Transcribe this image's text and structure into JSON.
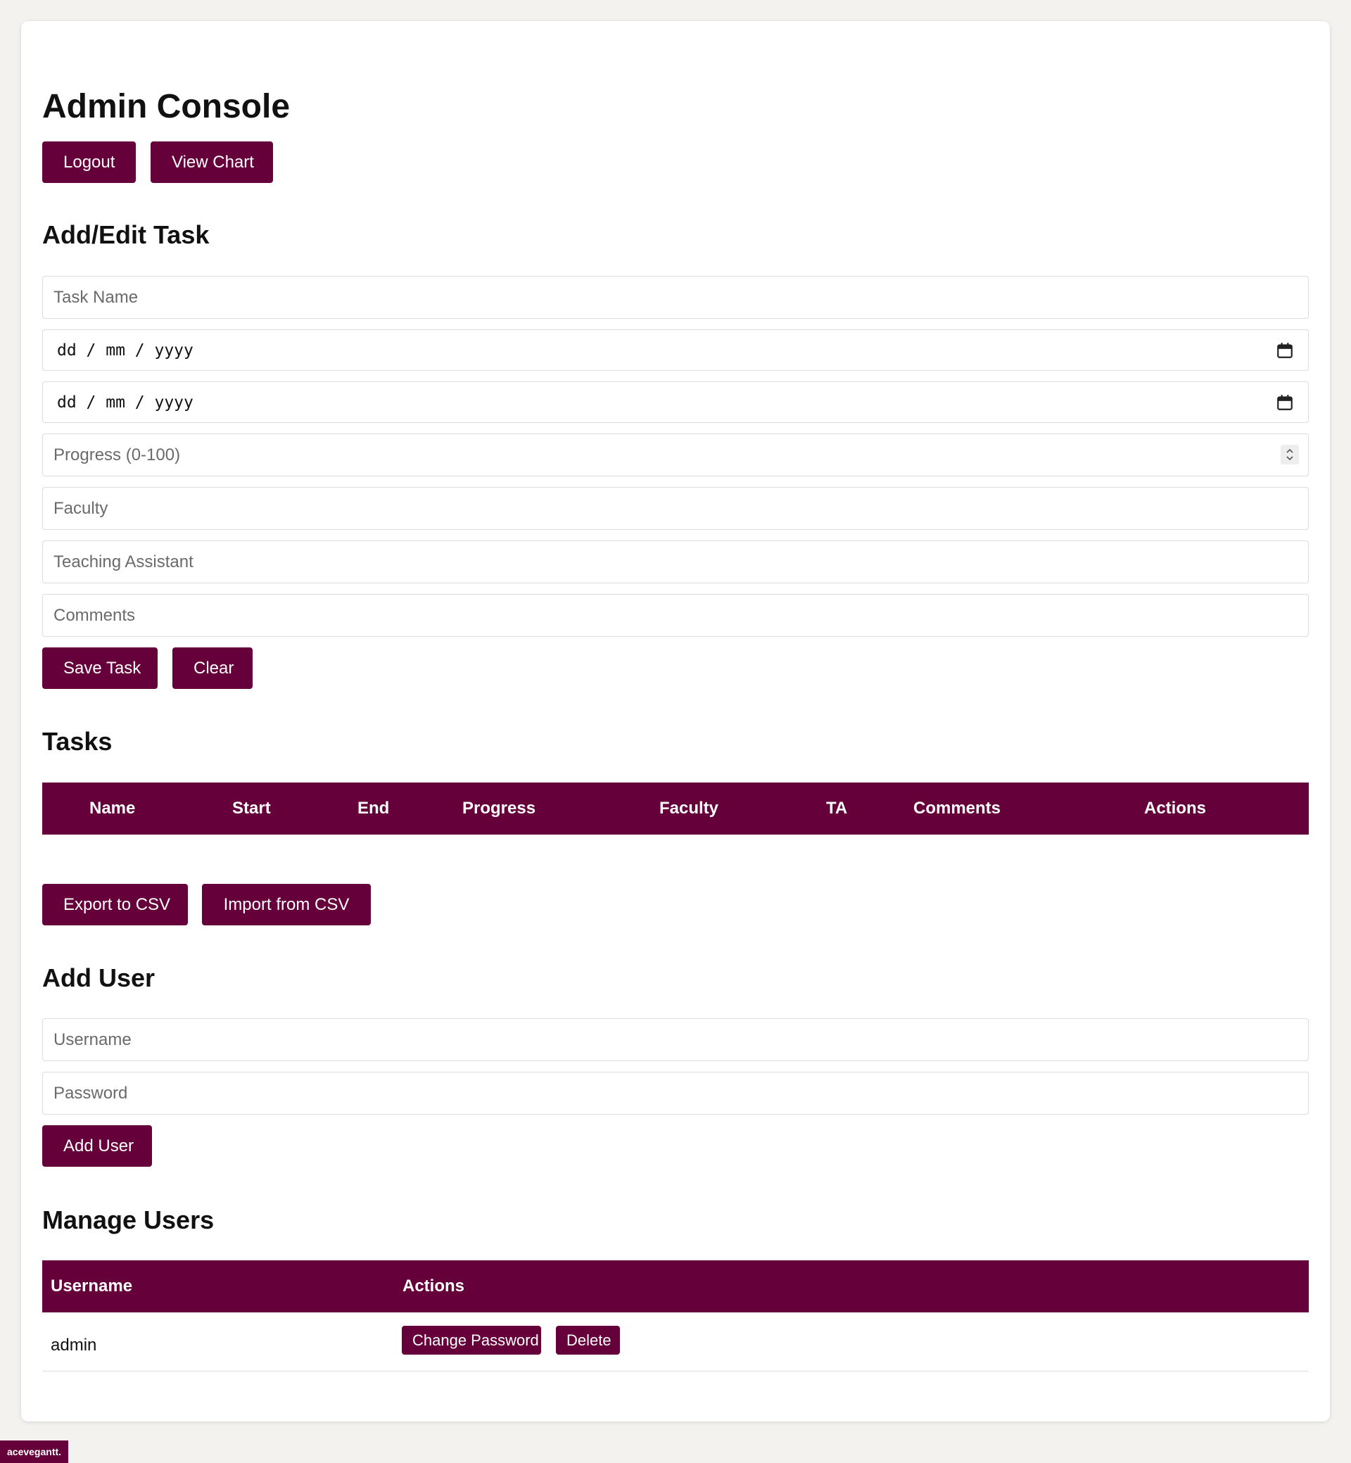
{
  "header": {
    "title": "Admin Console",
    "logout_label": "Logout",
    "view_chart_label": "View Chart"
  },
  "task_form": {
    "heading": "Add/Edit Task",
    "task_name_placeholder": "Task Name",
    "start_date_text": "dd / mm / yyyy",
    "end_date_text": "dd / mm / yyyy",
    "progress_placeholder": "Progress (0-100)",
    "faculty_placeholder": "Faculty",
    "ta_placeholder": "Teaching Assistant",
    "comments_placeholder": "Comments",
    "save_label": "Save Task",
    "clear_label": "Clear"
  },
  "tasks": {
    "heading": "Tasks",
    "columns": [
      "Name",
      "Start",
      "End",
      "Progress",
      "Faculty",
      "TA",
      "Comments",
      "Actions"
    ],
    "export_label": "Export to CSV",
    "import_label": "Import from CSV"
  },
  "add_user": {
    "heading": "Add User",
    "username_placeholder": "Username",
    "password_placeholder": "Password",
    "button_label": "Add User"
  },
  "manage_users": {
    "heading": "Manage Users",
    "columns": [
      "Username",
      "Actions"
    ],
    "rows": [
      {
        "username": "admin",
        "change_password_label": "Change Password",
        "delete_label": "Delete"
      }
    ]
  },
  "footer": {
    "badge": "acevegantt."
  },
  "colors": {
    "accent": "#66003a",
    "background": "#f3f2ef"
  }
}
